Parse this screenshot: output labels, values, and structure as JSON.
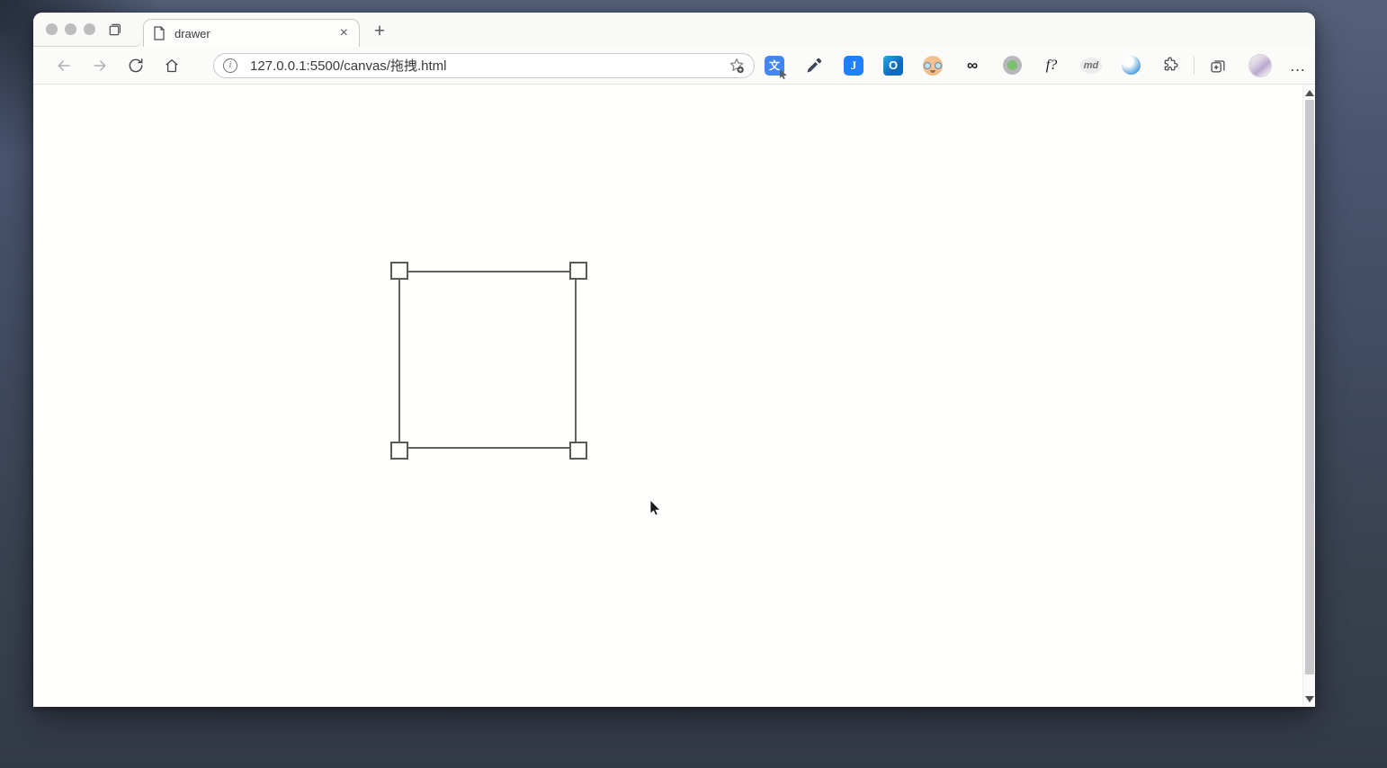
{
  "tab_strip": {
    "tab": {
      "title": "drawer",
      "close_glyph": "×"
    },
    "new_tab_glyph": "+"
  },
  "toolbar": {
    "url_bar": {
      "info_glyph": "i",
      "url": "127.0.0.1:5500/canvas/拖拽.html"
    },
    "extensions": {
      "translate": {
        "glyph": "文"
      },
      "juejin": {
        "glyph": "J"
      },
      "outlook": {
        "glyph": "O"
      },
      "infinity": {
        "glyph": "∞"
      },
      "fonts": {
        "glyph": "f?"
      },
      "markdown": {
        "glyph": "md"
      }
    },
    "more_menu_glyph": "…"
  },
  "content": {
    "shape": {
      "type": "rectangle-with-corner-handles",
      "handle_count": 4,
      "stroke_color": "#5f5f5f"
    }
  },
  "colors": {
    "desktop_background": "#414b61",
    "chrome_background": "#fbfbfa",
    "accent_blue": "#4285f4",
    "page_background": "#ffffff"
  }
}
